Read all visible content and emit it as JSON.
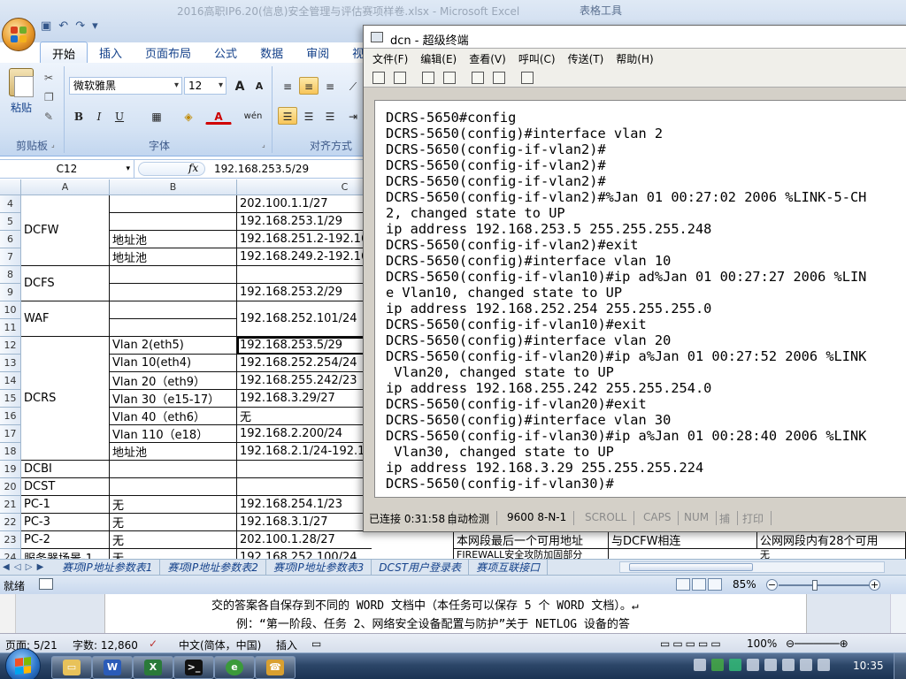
{
  "excel": {
    "caption": "2016高职IP6.20(信息)安全管理与评估赛项样卷.xlsx - Microsoft Excel",
    "tool_tab": "表格工具",
    "quick_access": {
      "save": "▣",
      "undo": "↶",
      "redo": "↷"
    },
    "ribbon_tabs": [
      "开始",
      "插入",
      "页面布局",
      "公式",
      "数据",
      "审阅",
      "视"
    ],
    "clipboard": {
      "paste": "粘贴",
      "group": "剪贴板"
    },
    "font": {
      "name": "微软雅黑",
      "size": "12",
      "group": "字体",
      "grow": "A",
      "shrink": "A",
      "bold": "B",
      "italic": "I",
      "underline": "U",
      "wen": "wén"
    },
    "align": {
      "group": "对齐方式"
    },
    "name_box": "C12",
    "fx": "fx",
    "formula": "192.168.253.5/29",
    "columns": [
      "A",
      "B",
      "C"
    ],
    "rows": [
      "4",
      "5",
      "6",
      "7",
      "8",
      "9",
      "10",
      "11",
      "12",
      "13",
      "14",
      "15",
      "16",
      "17",
      "18",
      "19",
      "20",
      "21",
      "22",
      "23",
      "24"
    ],
    "devices": {
      "dcfw": "DCFW",
      "dcfs": "DCFS",
      "waf": "WAF",
      "dcrs": "DCRS",
      "dcbi": "DCBI",
      "dcst": "DCST",
      "pc1": "PC-1",
      "pc3": "PC-3",
      "pc2": "PC-2",
      "server1": "服务器场景-1"
    },
    "b": {
      "r6": "地址池",
      "r7": "地址池",
      "r12": "Vlan 2(eth5)",
      "r13": "Vlan 10(eth4)",
      "r14": "Vlan 20（eth9）",
      "r15": "Vlan 30（e15-17）",
      "r16": "Vlan 40（eth6）",
      "r17": "Vlan 110（e18）",
      "r18": "地址池",
      "r21": "无",
      "r22": "无",
      "r23": "无",
      "r24": "无"
    },
    "c": {
      "r4": "202.100.1.1/27",
      "r5": "192.168.253.1/29",
      "r6": "192.168.251.2-192.168",
      "r7": "192.168.249.2-192.168",
      "r9": "192.168.253.2/29",
      "r10": "192.168.252.101/24",
      "r12": "192.168.253.5/29",
      "r13": "192.168.252.254/24",
      "r14": "192.168.255.242/23",
      "r15": "192.168.3.29/27",
      "r16": "无",
      "r17": "192.168.2.200/24",
      "r18": "192.168.2.1/24-192.16",
      "r21": "192.168.254.1/23",
      "r22": "192.168.3.1/27",
      "r23": "202.100.1.28/27",
      "r24": "192.168.252.100/24"
    },
    "row23_extra": {
      "d": "本网段最后一个可用地址",
      "e": "与DCFW相连",
      "f": "公网网段内有28个可用"
    },
    "row24_extra": {
      "d": "FIREWALL安全攻防加固部分",
      "f": "无"
    },
    "sheet_nav": "◀ ◁ ▷ ▶",
    "sheet_tabs": [
      "赛项IP地址参数表1",
      "赛项IP地址参数表2",
      "赛项IP地址参数表3",
      "DCST用户登录表",
      "赛项互联接口"
    ],
    "status_ready": "就绪",
    "zoom": "85%"
  },
  "terminal": {
    "title": "dcn - 超级终端",
    "menu": [
      "文件(F)",
      "编辑(E)",
      "查看(V)",
      "呼叫(C)",
      "传送(T)",
      "帮助(H)"
    ],
    "lines": [
      "DCRS-5650#config",
      "DCRS-5650(config)#interface vlan 2",
      "DCRS-5650(config-if-vlan2)#",
      "DCRS-5650(config-if-vlan2)#",
      "DCRS-5650(config-if-vlan2)#",
      "DCRS-5650(config-if-vlan2)#%Jan 01 00:27:02 2006 %LINK-5-CH",
      "2, changed state to UP",
      "ip address 192.168.253.5 255.255.255.248",
      "DCRS-5650(config-if-vlan2)#exit",
      "DCRS-5650(config)#interface vlan 10",
      "DCRS-5650(config-if-vlan10)#ip ad%Jan 01 00:27:27 2006 %LIN",
      "e Vlan10, changed state to UP",
      "ip address 192.168.252.254 255.255.255.0",
      "DCRS-5650(config-if-vlan10)#exit",
      "DCRS-5650(config)#interface vlan 20",
      "DCRS-5650(config-if-vlan20)#ip a%Jan 01 00:27:52 2006 %LINK",
      " Vlan20, changed state to UP",
      "ip address 192.168.255.242 255.255.254.0",
      "DCRS-5650(config-if-vlan20)#exit",
      "DCRS-5650(config)#interface vlan 30",
      "DCRS-5650(config-if-vlan30)#ip a%Jan 01 00:28:40 2006 %LINK",
      " Vlan30, changed state to UP",
      "ip address 192.168.3.29 255.255.255.224",
      "DCRS-5650(config-if-vlan30)#"
    ],
    "status": {
      "connected": "已连接 0:31:58",
      "detect": "自动检测",
      "params": "9600 8-N-1",
      "scroll": "SCROLL",
      "caps": "CAPS",
      "num": "NUM",
      "capture": "捕",
      "print": "打印"
    }
  },
  "word": {
    "line1": "交的答案各自保存到不同的 WORD 文档中（本任务可以保存 5 个 WORD 文档）。↵",
    "line2": "例：“第一阶段、任务 2、网络安全设备配置与防护”关于 NETLOG 设备的答",
    "page": "页面: 5/21",
    "words": "字数: 12,860",
    "lang": "中文(简体，中国)",
    "mode": "插入",
    "zoom": "100%"
  },
  "taskbar": {
    "clock": "10:35"
  },
  "colors": {
    "accent": "#15428b",
    "ribbon": "#d5e3f4",
    "terminal_bg": "#ffffff"
  }
}
